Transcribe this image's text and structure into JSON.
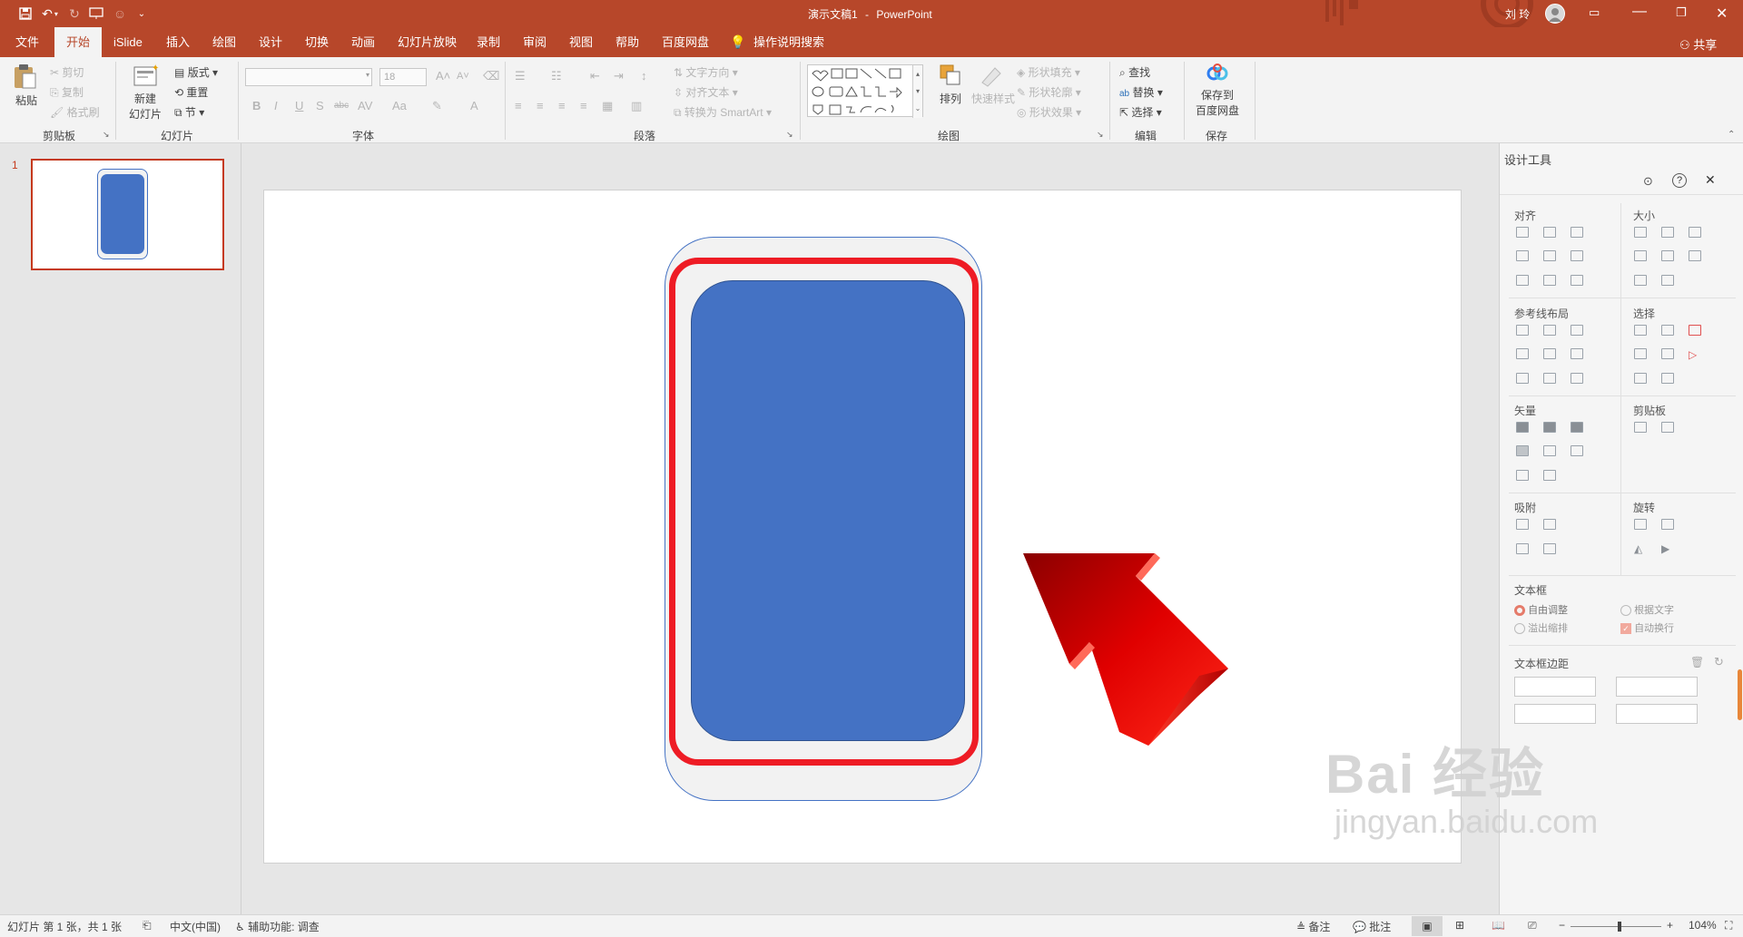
{
  "app": {
    "doc_title": "演示文稿1",
    "separator": "-",
    "app_name": "PowerPoint",
    "user_name": "刘 玲",
    "share_label": "共享",
    "tell_me": "操作说明搜索"
  },
  "quick_access": {
    "icons": [
      "save-icon",
      "undo-icon",
      "redo-icon",
      "present-icon",
      "customize-icon"
    ]
  },
  "tabs": [
    {
      "label": "文件"
    },
    {
      "label": "开始",
      "active": true
    },
    {
      "label": "iSlide"
    },
    {
      "label": "插入"
    },
    {
      "label": "绘图"
    },
    {
      "label": "设计"
    },
    {
      "label": "切换"
    },
    {
      "label": "动画"
    },
    {
      "label": "幻灯片放映"
    },
    {
      "label": "录制"
    },
    {
      "label": "审阅"
    },
    {
      "label": "视图"
    },
    {
      "label": "帮助"
    },
    {
      "label": "百度网盘"
    }
  ],
  "ribbon": {
    "clipboard": {
      "paste": "粘贴",
      "cut": "剪切",
      "copy": "复制",
      "format_painter": "格式刷",
      "group": "剪贴板"
    },
    "slides": {
      "new_slide_1": "新建",
      "new_slide_2": "幻灯片",
      "layout": "版式",
      "reset": "重置",
      "section": "节",
      "group": "幻灯片"
    },
    "font": {
      "font_size": "18",
      "group": "字体",
      "bold": "B",
      "italic": "I",
      "underline": "U",
      "shadow": "S",
      "strike": "abc",
      "spacing": "AV",
      "case": "Aa",
      "grow": "A",
      "shrink": "A"
    },
    "paragraph": {
      "text_direction": "文字方向",
      "align_text": "对齐文本",
      "smartart": "转换为 SmartArt",
      "group": "段落"
    },
    "drawing": {
      "arrange": "排列",
      "quick_styles": "快速样式",
      "shape_fill": "形状填充",
      "shape_outline": "形状轮廓",
      "shape_effects": "形状效果",
      "group": "绘图"
    },
    "editing": {
      "find": "查找",
      "replace": "替换",
      "select": "选择",
      "group": "编辑"
    },
    "save": {
      "save_to_1": "保存到",
      "save_to_2": "百度网盘",
      "group": "保存"
    }
  },
  "thumbnails": [
    {
      "number": "1"
    }
  ],
  "design_pane": {
    "title": "设计工具",
    "sections": {
      "align": "对齐",
      "size": "大小",
      "guides": "参考线布局",
      "select": "选择",
      "vector": "矢量",
      "clipboard": "剪贴板",
      "snap": "吸附",
      "rotate": "旋转",
      "textbox": "文本框",
      "margins": "文本框边距"
    },
    "textbox_options": {
      "free_adjust": "自由调整",
      "fit_text": "根据文字",
      "overflow_shrink": "溢出缩排",
      "auto_wrap": "自动换行"
    }
  },
  "status": {
    "slide_info": "幻灯片 第 1 张，共 1 张",
    "language": "中文(中国)",
    "accessibility": "辅助功能: 调查",
    "notes": "备注",
    "comments": "批注",
    "zoom": "104%"
  },
  "slide": {
    "card_outer_fill": "#f2f2f2",
    "card_outer_stroke": "#4472c4",
    "highlight_stroke": "#ee1c25",
    "card_inner_fill": "#4472c4",
    "arrow_color": "#e00000"
  },
  "watermark": {
    "line1": "Bai 经验",
    "line2": "jingyan.baidu.com"
  },
  "colors": {
    "brand": "#b7472a",
    "selection": "#c5391c"
  }
}
